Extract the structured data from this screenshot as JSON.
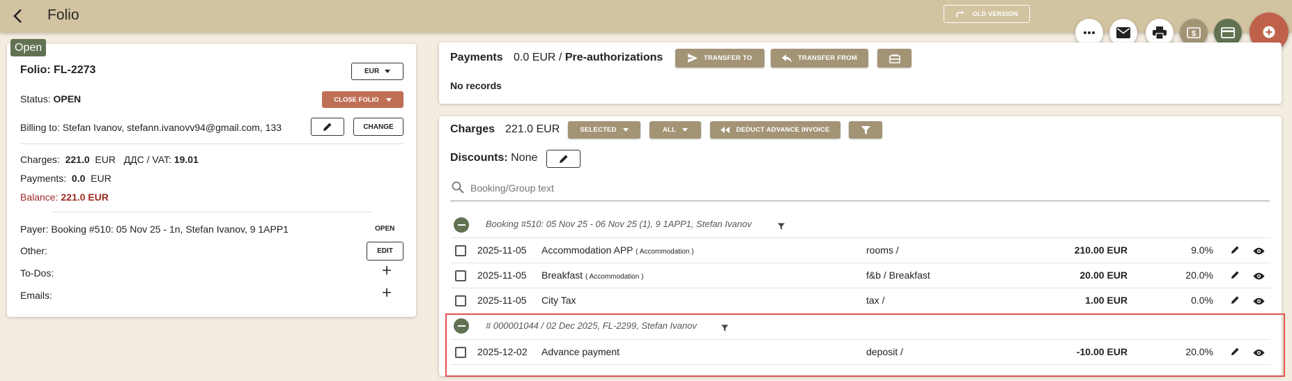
{
  "header": {
    "title": "Folio",
    "old_version_label": "OLD VERSION"
  },
  "colors": {
    "topbar": "#d2c3a1",
    "accent_tan": "#a39476",
    "close_red": "#c06f57",
    "status_green": "#617252",
    "fab_red": "#c0614c",
    "balance_red": "#9c2a23"
  },
  "folio": {
    "open_badge": "Open",
    "title": "Folio: FL-2273",
    "currency": "EUR",
    "status_label": "Status:",
    "status_value": "OPEN",
    "close_label": "CLOSE FOLIO",
    "billing_text": "Billing to: Stefan Ivanov, stefann.ivanovv94@gmail.com, 133",
    "change_label": "CHANGE",
    "charges_label": "Charges:",
    "charges_value": "221.0",
    "charges_currency": "EUR",
    "vat_label": "ДДС / VAT:",
    "vat_value": "19.01",
    "payments_label": "Payments:",
    "payments_value": "0.0",
    "payments_currency": "EUR",
    "balance_label": "Balance:",
    "balance_value": "221.0 EUR",
    "payer_text": "Payer: Booking #510: 05 Nov 25 - 1n, Stefan Ivanov, 9 1APP1",
    "payer_open": "OPEN",
    "other_label": "Other:",
    "edit_label": "EDIT",
    "todos_label": "To-Dos:",
    "emails_label": "Emails:"
  },
  "payments": {
    "title": "Payments",
    "amount": "0.0 EUR /",
    "preauth": "Pre-authorizations",
    "transfer_to": "TRANSFER TO",
    "transfer_from": "TRANSFER FROM",
    "no_records": "No records"
  },
  "charges": {
    "title": "Charges",
    "amount": "221.0 EUR",
    "selected": "SELECTED",
    "all": "ALL",
    "deduct": "DEDUCT ADVANCE INVOICE",
    "discounts_label": "Discounts:",
    "discounts_value": "None",
    "search_placeholder": "Booking/Group text",
    "groups": [
      {
        "title": "Booking #510: 05 Nov 25 - 06 Nov 25 (1), 9 1APP1, Stefan Ivanov",
        "rows": [
          {
            "date": "2025-11-05",
            "name": "Accommodation APP",
            "tag": "( Accommodation )",
            "category": "rooms /",
            "amount": "210.00 EUR",
            "vat": "9.0%"
          },
          {
            "date": "2025-11-05",
            "name": "Breakfast",
            "tag": "( Accommodation )",
            "category": "f&b / Breakfast",
            "amount": "20.00 EUR",
            "vat": "20.0%"
          },
          {
            "date": "2025-11-05",
            "name": "City Tax",
            "tag": "",
            "category": "tax /",
            "amount": "1.00 EUR",
            "vat": "0.0%"
          }
        ]
      },
      {
        "title": "# 000001044 / 02 Dec 2025, FL-2299, Stefan Ivanov",
        "rows": [
          {
            "date": "2025-12-02",
            "name": "Advance payment",
            "tag": "",
            "category": "deposit /",
            "amount": "-10.00 EUR",
            "vat": "20.0%"
          }
        ]
      }
    ]
  }
}
